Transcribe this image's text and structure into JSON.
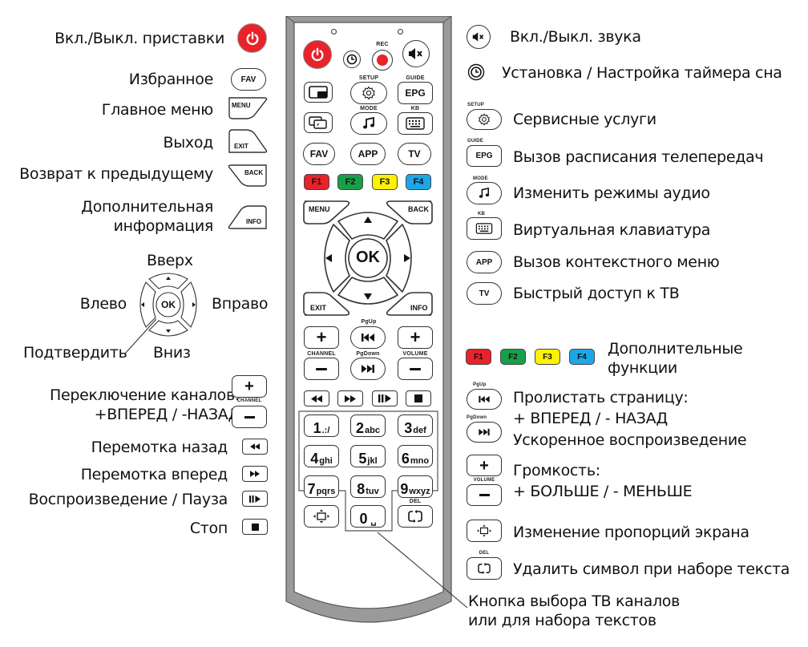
{
  "remote": {
    "power_label": "",
    "rec_label": "REC",
    "setup_label": "SETUP",
    "guide_label": "GUIDE",
    "epg_label": "EPG",
    "mode_label": "MODE",
    "kb_label": "KB",
    "fav_label": "FAV",
    "app_label": "APP",
    "tv_label": "TV",
    "f_keys": [
      {
        "label": "F1",
        "color": "#e8232a"
      },
      {
        "label": "F2",
        "color": "#17a04a"
      },
      {
        "label": "F3",
        "color": "#fff200"
      },
      {
        "label": "F4",
        "color": "#1ea7e8"
      }
    ],
    "menu_label": "MENU",
    "back_label": "BACK",
    "ok_label": "OK",
    "exit_label": "EXIT",
    "info_label": "INFO",
    "pgup_label": "PgUp",
    "pgdown_label": "PgDown",
    "channel_label": "CHANNEL",
    "volume_label": "VOLUME",
    "del_label": "DEL",
    "numpad": [
      {
        "digit": "1",
        "sub": ".:/"
      },
      {
        "digit": "2",
        "sub": "abc"
      },
      {
        "digit": "3",
        "sub": "def"
      },
      {
        "digit": "4",
        "sub": "ghi"
      },
      {
        "digit": "5",
        "sub": "jkl"
      },
      {
        "digit": "6",
        "sub": "mno"
      },
      {
        "digit": "7",
        "sub": "pqrs"
      },
      {
        "digit": "8",
        "sub": "tuv"
      },
      {
        "digit": "9",
        "sub": "wxyz"
      },
      {
        "digit": "0",
        "sub": "␣"
      }
    ]
  },
  "left_legend": {
    "power": "Вкл./Выкл. приставки",
    "fav": "Избранное",
    "menu": "Главное меню",
    "exit": "Выход",
    "back": "Возврат к предыдущему",
    "info_line1": "Дополнительная",
    "info_line2": "информация",
    "up": "Вверх",
    "left": "Влево",
    "right": "Вправо",
    "confirm": "Подтвердить",
    "down": "Вниз",
    "channel_line1": "Переключение каналов:",
    "channel_line2": "+ВПЕРЕД / -НАЗАД",
    "rewind": "Перемотка назад",
    "forward": "Перемотка вперед",
    "play_pause": "Воспроизведение / Пауза",
    "stop": "Стоп"
  },
  "right_legend": {
    "mute": "Вкл./Выкл. звука",
    "timer": "Установка / Настройка таймера сна",
    "setup": "Сервисные услуги",
    "epg": "Вызов расписания телепередач",
    "mode": "Изменить режимы аудио",
    "kb": "Виртуальная клавиатура",
    "app": "Вызов контекстного меню",
    "tv": "Быстрый доступ к ТВ",
    "fkeys_line1": "Дополнительные",
    "fkeys_line2": "функции",
    "page_line1": "Пролистать страницу:",
    "page_line2": "+ ВПЕРЕД / - НАЗАД",
    "page_line3": "Ускоренное воспроизведение",
    "volume_line1": "Громкость:",
    "volume_line2": "+ БОЛЬШЕ / - МЕНЬШЕ",
    "aspect": "Изменение пропорций экрана",
    "del": "Удалить символ при наборе текста",
    "zero_line1": "Кнопка выбора ТВ каналов",
    "zero_line2": "или для набора текстов"
  },
  "legend_keys": {
    "fav": "FAV",
    "menu": "MENU",
    "exit": "EXIT",
    "back": "BACK",
    "info": "INFO",
    "ok": "OK",
    "channel": "CHANNEL",
    "setup": "SETUP",
    "guide": "GUIDE",
    "epg": "EPG",
    "mode": "MODE",
    "kb": "KB",
    "app": "APP",
    "tv": "TV",
    "pgup": "PgUp",
    "pgdown": "PgDown",
    "volume": "VOLUME",
    "del": "DEL"
  }
}
